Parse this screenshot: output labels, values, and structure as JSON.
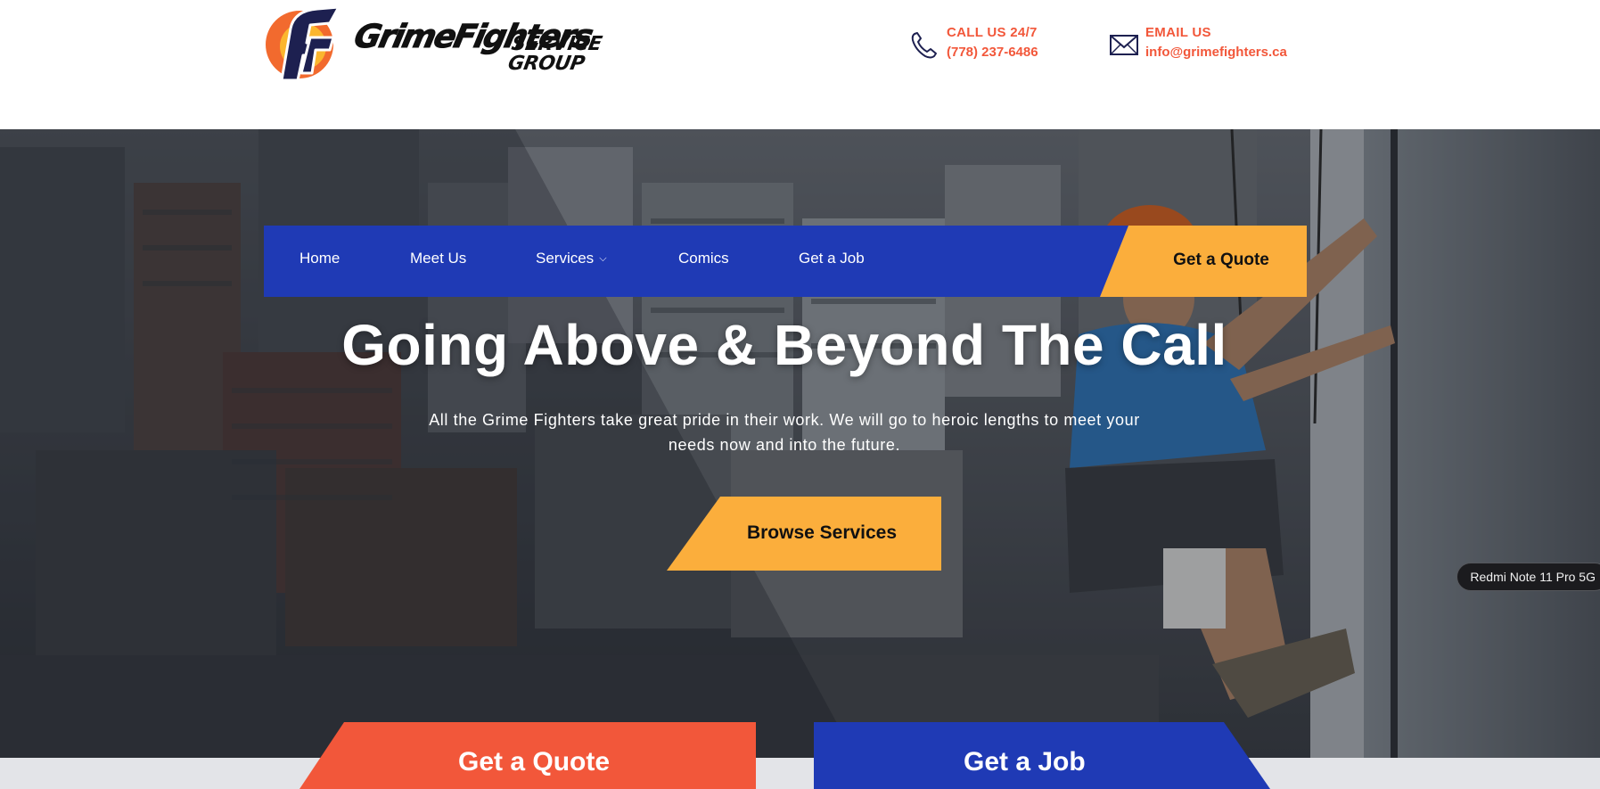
{
  "header": {
    "logo": {
      "brand_word": "GrimeFighters",
      "sub_word": "SERVICE GROUP",
      "badge_letters": "GF"
    },
    "phone": {
      "label": "CALL US 24/7",
      "value": "(778) 237-6486",
      "icon": "phone-icon"
    },
    "email": {
      "label": "EMAIL US",
      "value": "info@grimefighters.ca",
      "icon": "envelope-icon"
    }
  },
  "nav": {
    "items": [
      {
        "label": "Home"
      },
      {
        "label": "Meet Us"
      },
      {
        "label": "Services",
        "icon": "chevron-down-icon"
      },
      {
        "label": "Comics"
      },
      {
        "label": "Get a Job"
      }
    ],
    "cta": "Get a Quote"
  },
  "hero": {
    "title": "Going Above & Beyond The Call",
    "subtitle": "All the Grime Fighters take great pride in their work. We will go to heroic lengths to meet your needs now and into the future.",
    "button": "Browse Services"
  },
  "overlay": {
    "device_tag": "Redmi Note 11 Pro 5G"
  },
  "bottom": {
    "quote_label": "Get a Quote",
    "job_label": "Get a Job"
  },
  "colors": {
    "brand_blue": "#1f3ab5",
    "accent_yellow": "#fbae3c",
    "accent_red": "#f2573a"
  }
}
